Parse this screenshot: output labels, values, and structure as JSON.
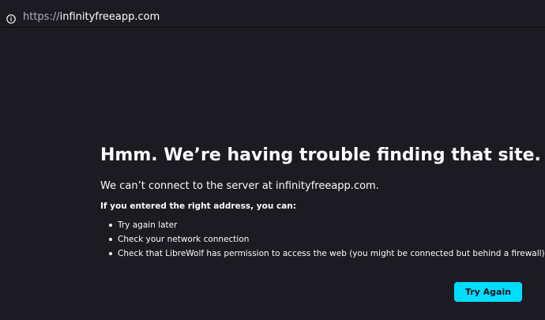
{
  "browser": {
    "url_scheme": "https://",
    "url_host": "infinityfreeapp.com",
    "info_icon": "info-icon"
  },
  "error_page": {
    "title": "Hmm. We’re having trouble finding that site.",
    "description": "We can’t connect to the server at infinityfreeapp.com.",
    "subheading": "If you entered the right address, you can:",
    "suggestions": [
      "Try again later",
      "Check your network connection",
      "Check that LibreWolf has permission to access the web (you might be connected but behind a firewall)"
    ],
    "try_again_label": "Try Again"
  },
  "colors": {
    "background": "#1c1b22",
    "text": "#fbfbfe",
    "accent_button": "#00ddff",
    "button_text": "#15141a"
  }
}
